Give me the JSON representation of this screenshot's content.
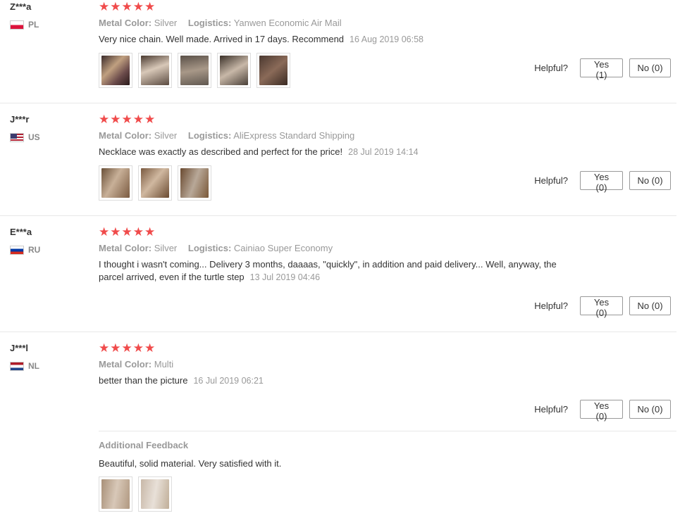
{
  "reviews": [
    {
      "user": "Z***a",
      "country": "PL",
      "stars": "★★★★★",
      "attrs": [
        {
          "key": "Metal Color:",
          "value": "Silver"
        },
        {
          "key": "Logistics:",
          "value": "Yanwen Economic Air Mail"
        }
      ],
      "text": "Very nice chain. Well made. Arrived in 17 days. Recommend",
      "date": "16 Aug 2019 06:58",
      "helpful_label": "Helpful?",
      "yes_label": "Yes (1)",
      "no_label": "No (0)"
    },
    {
      "user": "J***r",
      "country": "US",
      "stars": "★★★★★",
      "attrs": [
        {
          "key": "Metal Color:",
          "value": "Silver"
        },
        {
          "key": "Logistics:",
          "value": "AliExpress Standard Shipping"
        }
      ],
      "text": "Necklace was exactly as described and perfect for the price!",
      "date": "28 Jul 2019 14:14",
      "helpful_label": "Helpful?",
      "yes_label": "Yes (0)",
      "no_label": "No (0)"
    },
    {
      "user": "E***a",
      "country": "RU",
      "stars": "★★★★★",
      "attrs": [
        {
          "key": "Metal Color:",
          "value": "Silver"
        },
        {
          "key": "Logistics:",
          "value": "Cainiao Super Economy"
        }
      ],
      "text_line1": "I thought i wasn't coming... Delivery 3 months, daaaas, \"quickly\", in addition and paid delivery... Well, anyway, the",
      "text_line2": "parcel arrived, even if the turtle step",
      "date": "13 Jul 2019 04:46",
      "helpful_label": "Helpful?",
      "yes_label": "Yes (0)",
      "no_label": "No (0)"
    },
    {
      "user": "J***l",
      "country": "NL",
      "stars": "★★★★★",
      "attrs": [
        {
          "key": "Metal Color:",
          "value": "Multi"
        }
      ],
      "text": "better than the picture",
      "date": "16 Jul 2019 06:21",
      "helpful_label": "Helpful?",
      "yes_label": "Yes (0)",
      "no_label": "No (0)",
      "additional": {
        "title": "Additional Feedback",
        "text": "Beautiful, solid material. Very satisfied with it."
      }
    }
  ],
  "colors": {
    "star": "#f04b4b",
    "muted": "#999999",
    "text": "#333333"
  }
}
